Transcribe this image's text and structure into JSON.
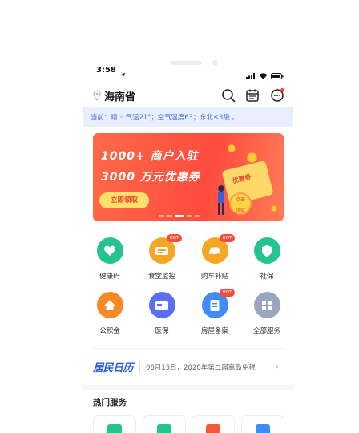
{
  "status": {
    "time": "3:58"
  },
  "header": {
    "location": "海南省"
  },
  "weather_text": "当前：晴 ◦ 气温21°；空气湿度63；东北≤3级 。",
  "banner": {
    "line1": "1000+ 商户入驻",
    "line2": "3000 万元优惠券",
    "button": "立即领取",
    "coupon": "优惠券",
    "badge_l1": "点击",
    "badge_l2": "领取"
  },
  "services": [
    {
      "label": "健康码",
      "color": "#23c48e",
      "icon": "heart-icon",
      "hot": ""
    },
    {
      "label": "食堂监控",
      "color": "#f5a623",
      "icon": "canteen-icon",
      "hot": "HOT"
    },
    {
      "label": "购车补贴",
      "color": "#f5a623",
      "icon": "car-icon",
      "hot": "HOT"
    },
    {
      "label": "社保",
      "color": "#23c48e",
      "icon": "shield-icon",
      "hot": ""
    },
    {
      "label": "公积金",
      "color": "#f58a23",
      "icon": "house-icon",
      "hot": ""
    },
    {
      "label": "医保",
      "color": "#5b6ef5",
      "icon": "card-icon",
      "hot": ""
    },
    {
      "label": "房屋备案",
      "color": "#3f8cf7",
      "icon": "document-icon",
      "hot": "HOT"
    },
    {
      "label": "全部服务",
      "color": "#9aa6bf",
      "icon": "grid-icon",
      "hot": ""
    }
  ],
  "calendar": {
    "logo": "居民日历",
    "text": "06月15日，2020年第二届离岛免税",
    "arrow": "›"
  },
  "hot_services": {
    "title": "热门服务"
  }
}
